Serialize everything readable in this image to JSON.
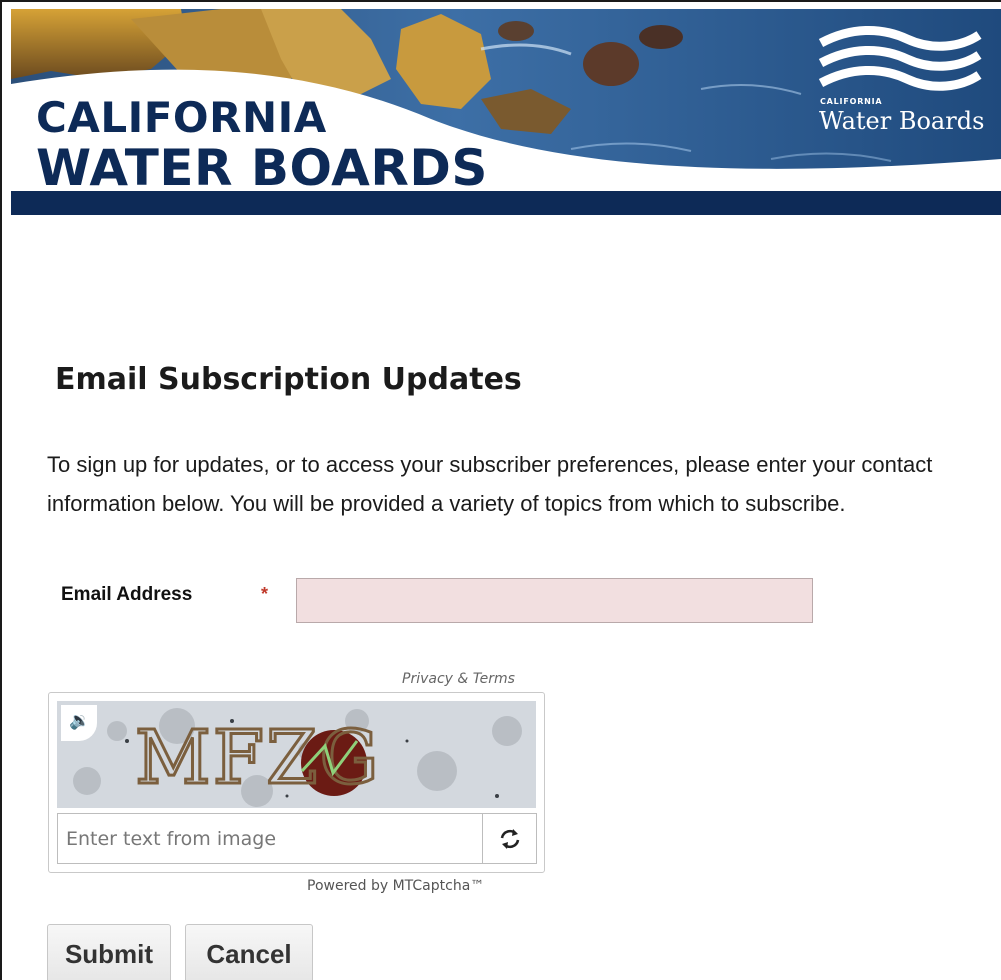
{
  "header": {
    "brand_line1": "CALIFORNIA",
    "brand_line2": "WATER BOARDS",
    "logo_small": "CALIFORNIA",
    "logo_big": "Water Boards",
    "navy": "#0d2a57"
  },
  "form": {
    "title": "Email Subscription Updates",
    "intro": "To sign up for updates, or to access your subscriber preferences, please enter your contact information below. You will be provided a variety of topics from which to subscribe.",
    "email_label": "Email Address",
    "required_mark": "*",
    "email_value": ""
  },
  "captcha": {
    "privacy_link": "Privacy & Terms",
    "challenge_text": "MFZG",
    "input_placeholder": "Enter text from image",
    "powered_by": "Powered by MTCaptcha™",
    "audio_icon": "speaker-icon",
    "refresh_icon": "refresh-icon"
  },
  "buttons": {
    "submit": "Submit",
    "cancel": "Cancel"
  }
}
